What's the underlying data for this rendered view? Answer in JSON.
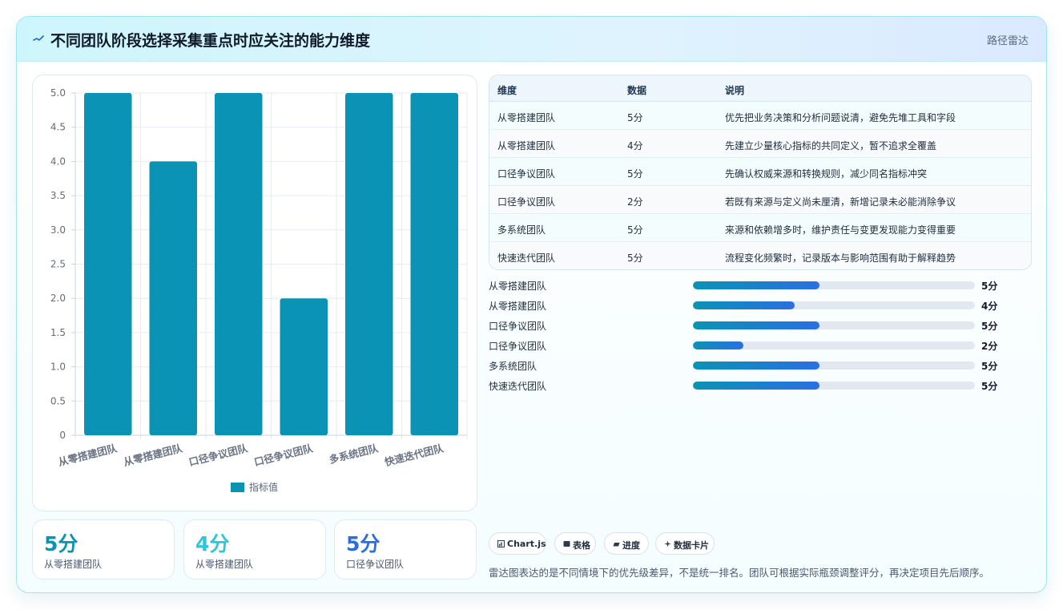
{
  "header": {
    "title": "不同团队阶段选择采集重点时应关注的能力维度",
    "tag": "路径雷达"
  },
  "chart_data": {
    "type": "bar",
    "categories": [
      "从零搭建团队",
      "从零搭建团队",
      "口径争议团队",
      "口径争议团队",
      "多系统团队",
      "快速迭代团队"
    ],
    "series": [
      {
        "name": "指标值",
        "values": [
          5,
          4,
          5,
          2,
          5,
          5
        ]
      }
    ],
    "ylim": [
      0,
      5
    ],
    "yticks": [
      "0",
      "0.5",
      "1.0",
      "1.5",
      "2.0",
      "2.5",
      "3.0",
      "3.5",
      "4.0",
      "4.5",
      "5.0"
    ],
    "grid": true,
    "legend": "bottom",
    "bar_color": "#0a93b5"
  },
  "stats": [
    {
      "value": "5分",
      "label": "从零搭建团队",
      "color": "#0a93b5"
    },
    {
      "value": "4分",
      "label": "从零搭建团队",
      "color": "#2cc7dd"
    },
    {
      "value": "5分",
      "label": "口径争议团队",
      "color": "#2a6fe2"
    }
  ],
  "table": {
    "headers": [
      "维度",
      "数据",
      "说明"
    ],
    "rows": [
      {
        "dim": "从零搭建团队",
        "data": "5分",
        "desc": "优先把业务决策和分析问题说清，避免先堆工具和字段"
      },
      {
        "dim": "从零搭建团队",
        "data": "4分",
        "desc": "先建立少量核心指标的共同定义，暂不追求全覆盖"
      },
      {
        "dim": "口径争议团队",
        "data": "5分",
        "desc": "先确认权威来源和转换规则，减少同名指标冲突"
      },
      {
        "dim": "口径争议团队",
        "data": "2分",
        "desc": "若既有来源与定义尚未厘清，新增记录未必能消除争议"
      },
      {
        "dim": "多系统团队",
        "data": "5分",
        "desc": "来源和依赖增多时，维护责任与变更发现能力变得重要"
      },
      {
        "dim": "快速迭代团队",
        "data": "5分",
        "desc": "流程变化频繁时，记录版本与影响范围有助于解释趋势"
      }
    ]
  },
  "progress": [
    {
      "label": "从零搭建团队",
      "value": "5分",
      "fraction": 0.45
    },
    {
      "label": "从零搭建团队",
      "value": "4分",
      "fraction": 0.36
    },
    {
      "label": "口径争议团队",
      "value": "5分",
      "fraction": 0.45
    },
    {
      "label": "口径争议团队",
      "value": "2分",
      "fraction": 0.18
    },
    {
      "label": "多系统团队",
      "value": "5分",
      "fraction": 0.45
    },
    {
      "label": "快速迭代团队",
      "value": "5分",
      "fraction": 0.45
    }
  ],
  "chips": [
    {
      "label": "Chart.js",
      "icon": "chart-icon"
    },
    {
      "label": "表格",
      "icon": "table-icon"
    },
    {
      "label": "进度",
      "icon": "progress-icon"
    },
    {
      "label": "数据卡片",
      "icon": "sparkle-icon"
    }
  ],
  "note": "雷达图表达的是不同情境下的优先级差异，不是统一排名。团队可根据实际瓶颈调整评分，再决定项目先后顺序。",
  "colors": {
    "accent": "#0a93b5",
    "accent2": "#2a6fe2",
    "grid": "#e6ebf0"
  }
}
